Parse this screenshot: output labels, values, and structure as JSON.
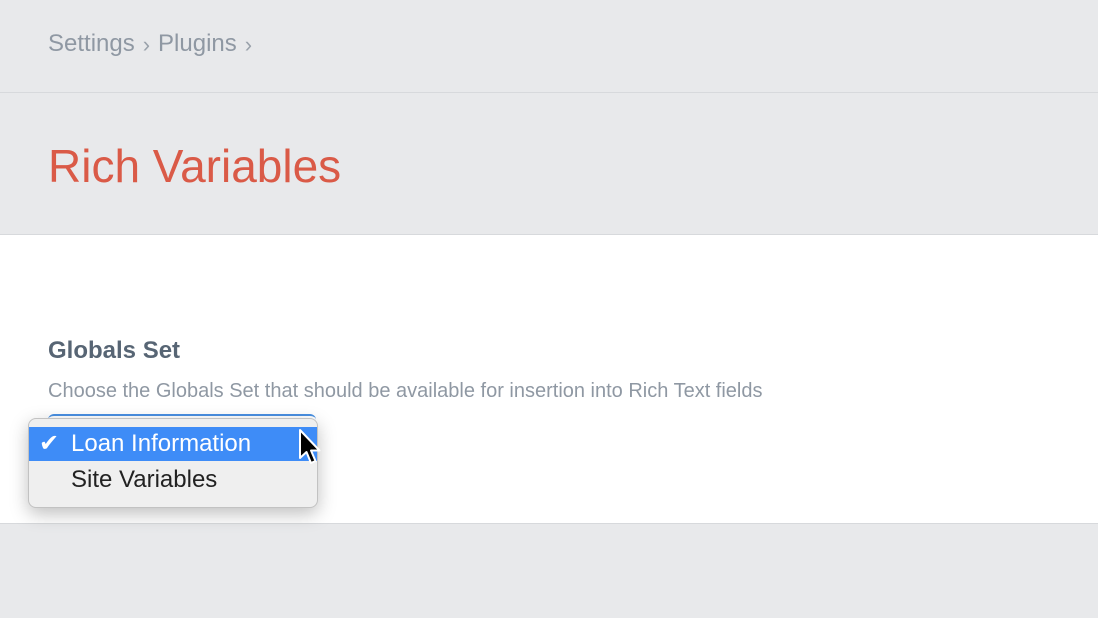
{
  "breadcrumb": {
    "items": [
      "Settings",
      "Plugins"
    ],
    "separator": "›"
  },
  "page": {
    "title": "Rich Variables",
    "title_color": "#da5a47"
  },
  "field": {
    "label": "Globals Set",
    "instructions": "Choose the Globals Set that should be available for insertion into Rich Text fields"
  },
  "dropdown": {
    "check_mark": "✔",
    "options": [
      {
        "label": "Loan Information",
        "selected": true
      },
      {
        "label": "Site Variables",
        "selected": false
      }
    ],
    "highlight_color": "#3e8cf7"
  },
  "icons": {
    "cursor": "mouse-pointer-icon"
  }
}
